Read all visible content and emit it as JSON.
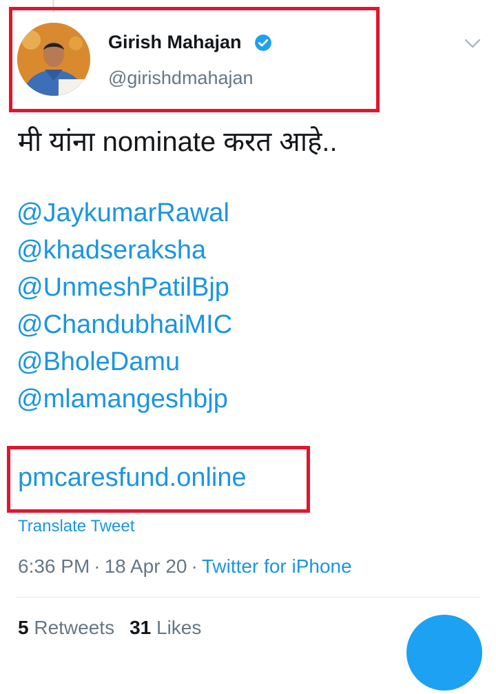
{
  "colors": {
    "link": "#1b95e0",
    "secondary_text": "#657786",
    "primary_text": "#14171a",
    "highlight": "#e0152d",
    "verified_badge": "#1da1f2"
  },
  "author": {
    "display_name": "Girish Mahajan",
    "handle": "@girishdmahajan",
    "verified_icon": "verified-badge-icon",
    "menu_icon": "chevron-down-icon"
  },
  "tweet": {
    "text": "मी यांना nominate करत आहे..",
    "mentions": [
      "@JaykumarRawal",
      "@khadseraksha",
      "@UnmeshPatilBjp",
      "@ChandubhaiMIC",
      "@BholeDamu",
      "@mlamangeshbjp"
    ],
    "link": "pmcaresfund.online",
    "translate_label": "Translate Tweet"
  },
  "meta": {
    "time": "6:36 PM",
    "separator": "·",
    "date": "18 Apr 20",
    "source": "Twitter for iPhone"
  },
  "stats": {
    "retweets_count": "5",
    "retweets_label": "Retweets",
    "likes_count": "31",
    "likes_label": "Likes"
  },
  "fab": {
    "icon": "compose-icon"
  }
}
